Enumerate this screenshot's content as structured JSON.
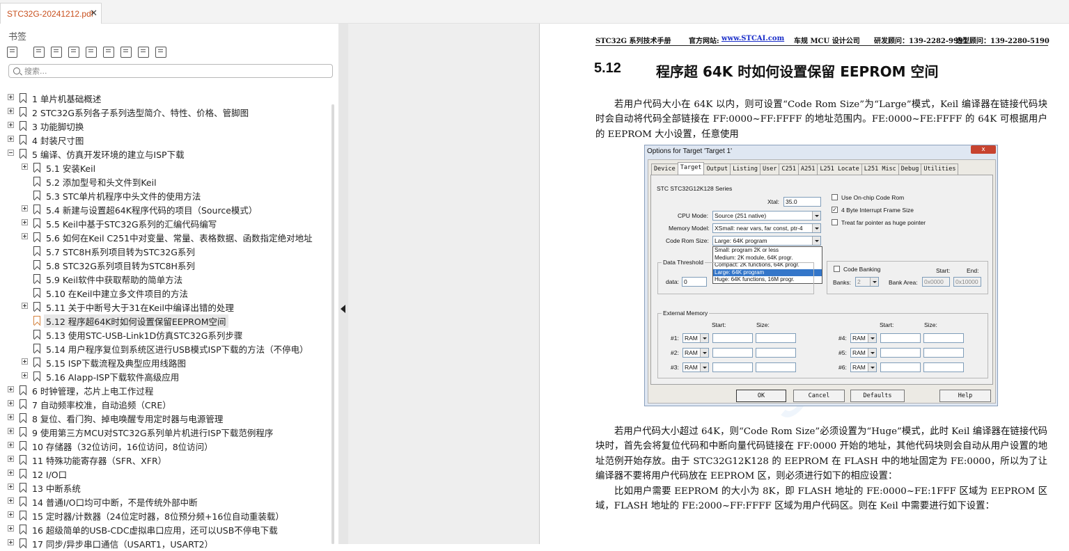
{
  "tab": {
    "title": "STC32G-20241212.pdf",
    "close": "✕"
  },
  "sidebar": {
    "title": "书签",
    "tools": [
      "outline-icon",
      "add-bookmark-icon",
      "delete-bookmark-icon",
      "bookmark-edit-icon",
      "font-larger-icon",
      "font-smaller-icon",
      "expand-icon",
      "collapse-icon",
      "find-bookmark-icon"
    ],
    "search_placeholder": "搜索...",
    "items": [
      {
        "label": "1 单片机基础概述",
        "level": 0,
        "expander": "plus"
      },
      {
        "label": "2 STC32G系列各子系列选型简介、特性、价格、管脚图",
        "level": 0,
        "expander": "plus"
      },
      {
        "label": "3 功能脚切换",
        "level": 0,
        "expander": "plus"
      },
      {
        "label": "4 封装尺寸图",
        "level": 0,
        "expander": "plus"
      },
      {
        "label": "5 编译、仿真开发环境的建立与ISP下载",
        "level": 0,
        "expander": "minus"
      },
      {
        "label": "5.1 安装Keil",
        "level": 1,
        "expander": "plus"
      },
      {
        "label": "5.2 添加型号和头文件到Keil",
        "level": 1,
        "expander": "none"
      },
      {
        "label": "5.3 STC单片机程序中头文件的使用方法",
        "level": 1,
        "expander": "none"
      },
      {
        "label": "5.4 新建与设置超64K程序代码的项目（Source模式）",
        "level": 1,
        "expander": "plus"
      },
      {
        "label": "5.5 Keil中基于STC32G系列的汇编代码编写",
        "level": 1,
        "expander": "plus"
      },
      {
        "label": "5.6 如何在Keil C251中对变量、常量、表格数据、函数指定绝对地址",
        "level": 1,
        "expander": "plus"
      },
      {
        "label": "5.7 STC8H系列项目转为STC32G系列",
        "level": 1,
        "expander": "none"
      },
      {
        "label": "5.8 STC32G系列项目转为STC8H系列",
        "level": 1,
        "expander": "none"
      },
      {
        "label": "5.9 Keil软件中获取帮助的简单方法",
        "level": 1,
        "expander": "none"
      },
      {
        "label": "5.10 在Keil中建立多文件项目的方法",
        "level": 1,
        "expander": "none"
      },
      {
        "label": "5.11 关于中断号大于31在Keil中编译出错的处理",
        "level": 1,
        "expander": "plus"
      },
      {
        "label": "5.12 程序超64K时如何设置保留EEPROM空间",
        "level": 1,
        "expander": "none",
        "selected": true
      },
      {
        "label": "5.13 使用STC-USB-Link1D仿真STC32G系列步骤",
        "level": 1,
        "expander": "none"
      },
      {
        "label": "5.14 用户程序复位到系统区进行USB模式ISP下载的方法（不停电）",
        "level": 1,
        "expander": "none"
      },
      {
        "label": "5.15 ISP下载流程及典型应用线路图",
        "level": 1,
        "expander": "plus"
      },
      {
        "label": "5.16 AIapp-ISP下载软件高级应用",
        "level": 1,
        "expander": "plus"
      },
      {
        "label": "6 时钟管理，芯片上电工作过程",
        "level": 0,
        "expander": "plus"
      },
      {
        "label": "7 自动频率校准，自动追频（CRE）",
        "level": 0,
        "expander": "plus"
      },
      {
        "label": "8 复位、看门狗、掉电唤醒专用定时器与电源管理",
        "level": 0,
        "expander": "plus"
      },
      {
        "label": "9 使用第三方MCU对STC32G系列单片机进行ISP下载范例程序",
        "level": 0,
        "expander": "plus"
      },
      {
        "label": "10 存储器（32位访问，16位访问，8位访问）",
        "level": 0,
        "expander": "plus"
      },
      {
        "label": "11 特殊功能寄存器（SFR、XFR）",
        "level": 0,
        "expander": "plus"
      },
      {
        "label": "12 I/O口",
        "level": 0,
        "expander": "plus"
      },
      {
        "label": "13 中断系统",
        "level": 0,
        "expander": "plus"
      },
      {
        "label": "14 普通I/O口均可中断，不是传统外部中断",
        "level": 0,
        "expander": "plus"
      },
      {
        "label": "15 定时器/计数器（24位定时器，8位预分频+16位自动重装载）",
        "level": 0,
        "expander": "plus"
      },
      {
        "label": "16 超级简单的USB-CDC虚拟串口应用，还可以USB不停电下载",
        "level": 0,
        "expander": "plus"
      },
      {
        "label": "17 同步/异步串口通信（USART1，USART2）",
        "level": 0,
        "expander": "plus"
      }
    ]
  },
  "page": {
    "header": {
      "doc": "STC32G 系列技术手册",
      "site_label": "官方网站:",
      "site": "www.STCAI.com",
      "company": "车规 MCU 设计公司",
      "consult1": "研发顾问：139-2282-9991",
      "consult2": "选型顾问：139-2280-5190"
    },
    "section_number": "5.12",
    "section_title": "程序超 64K 时如何设置保留 EEPROM 空间",
    "para1": "若用户代码大小在 64K 以内，则可设置“Code Rom Size”为“Large”模式，Keil 编译器在链接代码块时会自动将代码全部链接在 FF:0000~FF:FFFF 的地址范围内。FE:0000~FE:FFFF 的 64K 可根据用户的 EEPROM 大小设置，任意使用",
    "para2": "若用户代码大小超过 64K，则“Code Rom Size”必须设置为“Huge”模式，此时 Keil 编译器在链接代码块时，首先会将复位代码和中断向量代码链接在 FF:0000 开始的地址，其他代码块则会自动从用户设置的地址范例开始存放。由于 STC32G12K128 的 EEPROM 在 FLASH 中的地址固定为 FE:0000，所以为了让编译器不要将用户代码放在 EEPROM 区，则必须进行如下的相应设置：",
    "para3": "比如用户需要 EEPROM 的大小为 8K，即 FLASH 地址的 FE:0000~FE:1FFF 区域为 EEPROM 区域，FLASH 地址的 FE:2000~FF:FFFF 区域为用户代码区。则在 Keil 中需要进行如下设置：",
    "watermark": "STC"
  },
  "dialog": {
    "title": "Options for Target 'Target 1'",
    "close": "x",
    "tabs": [
      "Device",
      "Target",
      "Output",
      "Listing",
      "User",
      "C251",
      "A251",
      "L251 Locate",
      "L251 Misc",
      "Debug",
      "Utilities"
    ],
    "active_tab": "Target",
    "series": "STC STC32G12K128 Series",
    "xtal_label": "Xtal:",
    "xtal": "35.0",
    "cpu_mode_label": "CPU Mode:",
    "cpu_mode": "Source (251 native)",
    "memory_model_label": "Memory Model:",
    "memory_model": "XSmall: near vars, far const, ptr-4",
    "code_rom_label": "Code Rom Size:",
    "code_rom": "Large: 64K program",
    "code_rom_options": [
      "Small: program 2K or less",
      "Medium: 2K module, 64K progr.",
      "Compact: 2K functions, 64K progr.",
      "Large: 64K program",
      "Huge: 64K functions, 16M progr."
    ],
    "code_rom_highlight": 3,
    "chk_onchip": "Use On-chip Code Rom",
    "chk_4byte": "4 Byte Interrupt Frame Size",
    "chk_far": "Treat far pointer as huge pointer",
    "data_threshold": "Data Threshold",
    "data_label": "data:",
    "data_value": "0",
    "code_banking": "Code Banking",
    "banks_label": "Banks:",
    "banks": "2",
    "bank_area_label": "Bank Area:",
    "start_label": "Start:",
    "end_label": "End:",
    "bank_start": "0x0000",
    "bank_end": "0x10000",
    "ext_mem": "External Memory",
    "size_label": "Size:",
    "rows": [
      "#1:",
      "#2:",
      "#3:",
      "#4:",
      "#5:",
      "#6:"
    ],
    "ram": "RAM",
    "buttons": {
      "ok": "OK",
      "cancel": "Cancel",
      "defaults": "Defaults",
      "help": "Help"
    }
  }
}
